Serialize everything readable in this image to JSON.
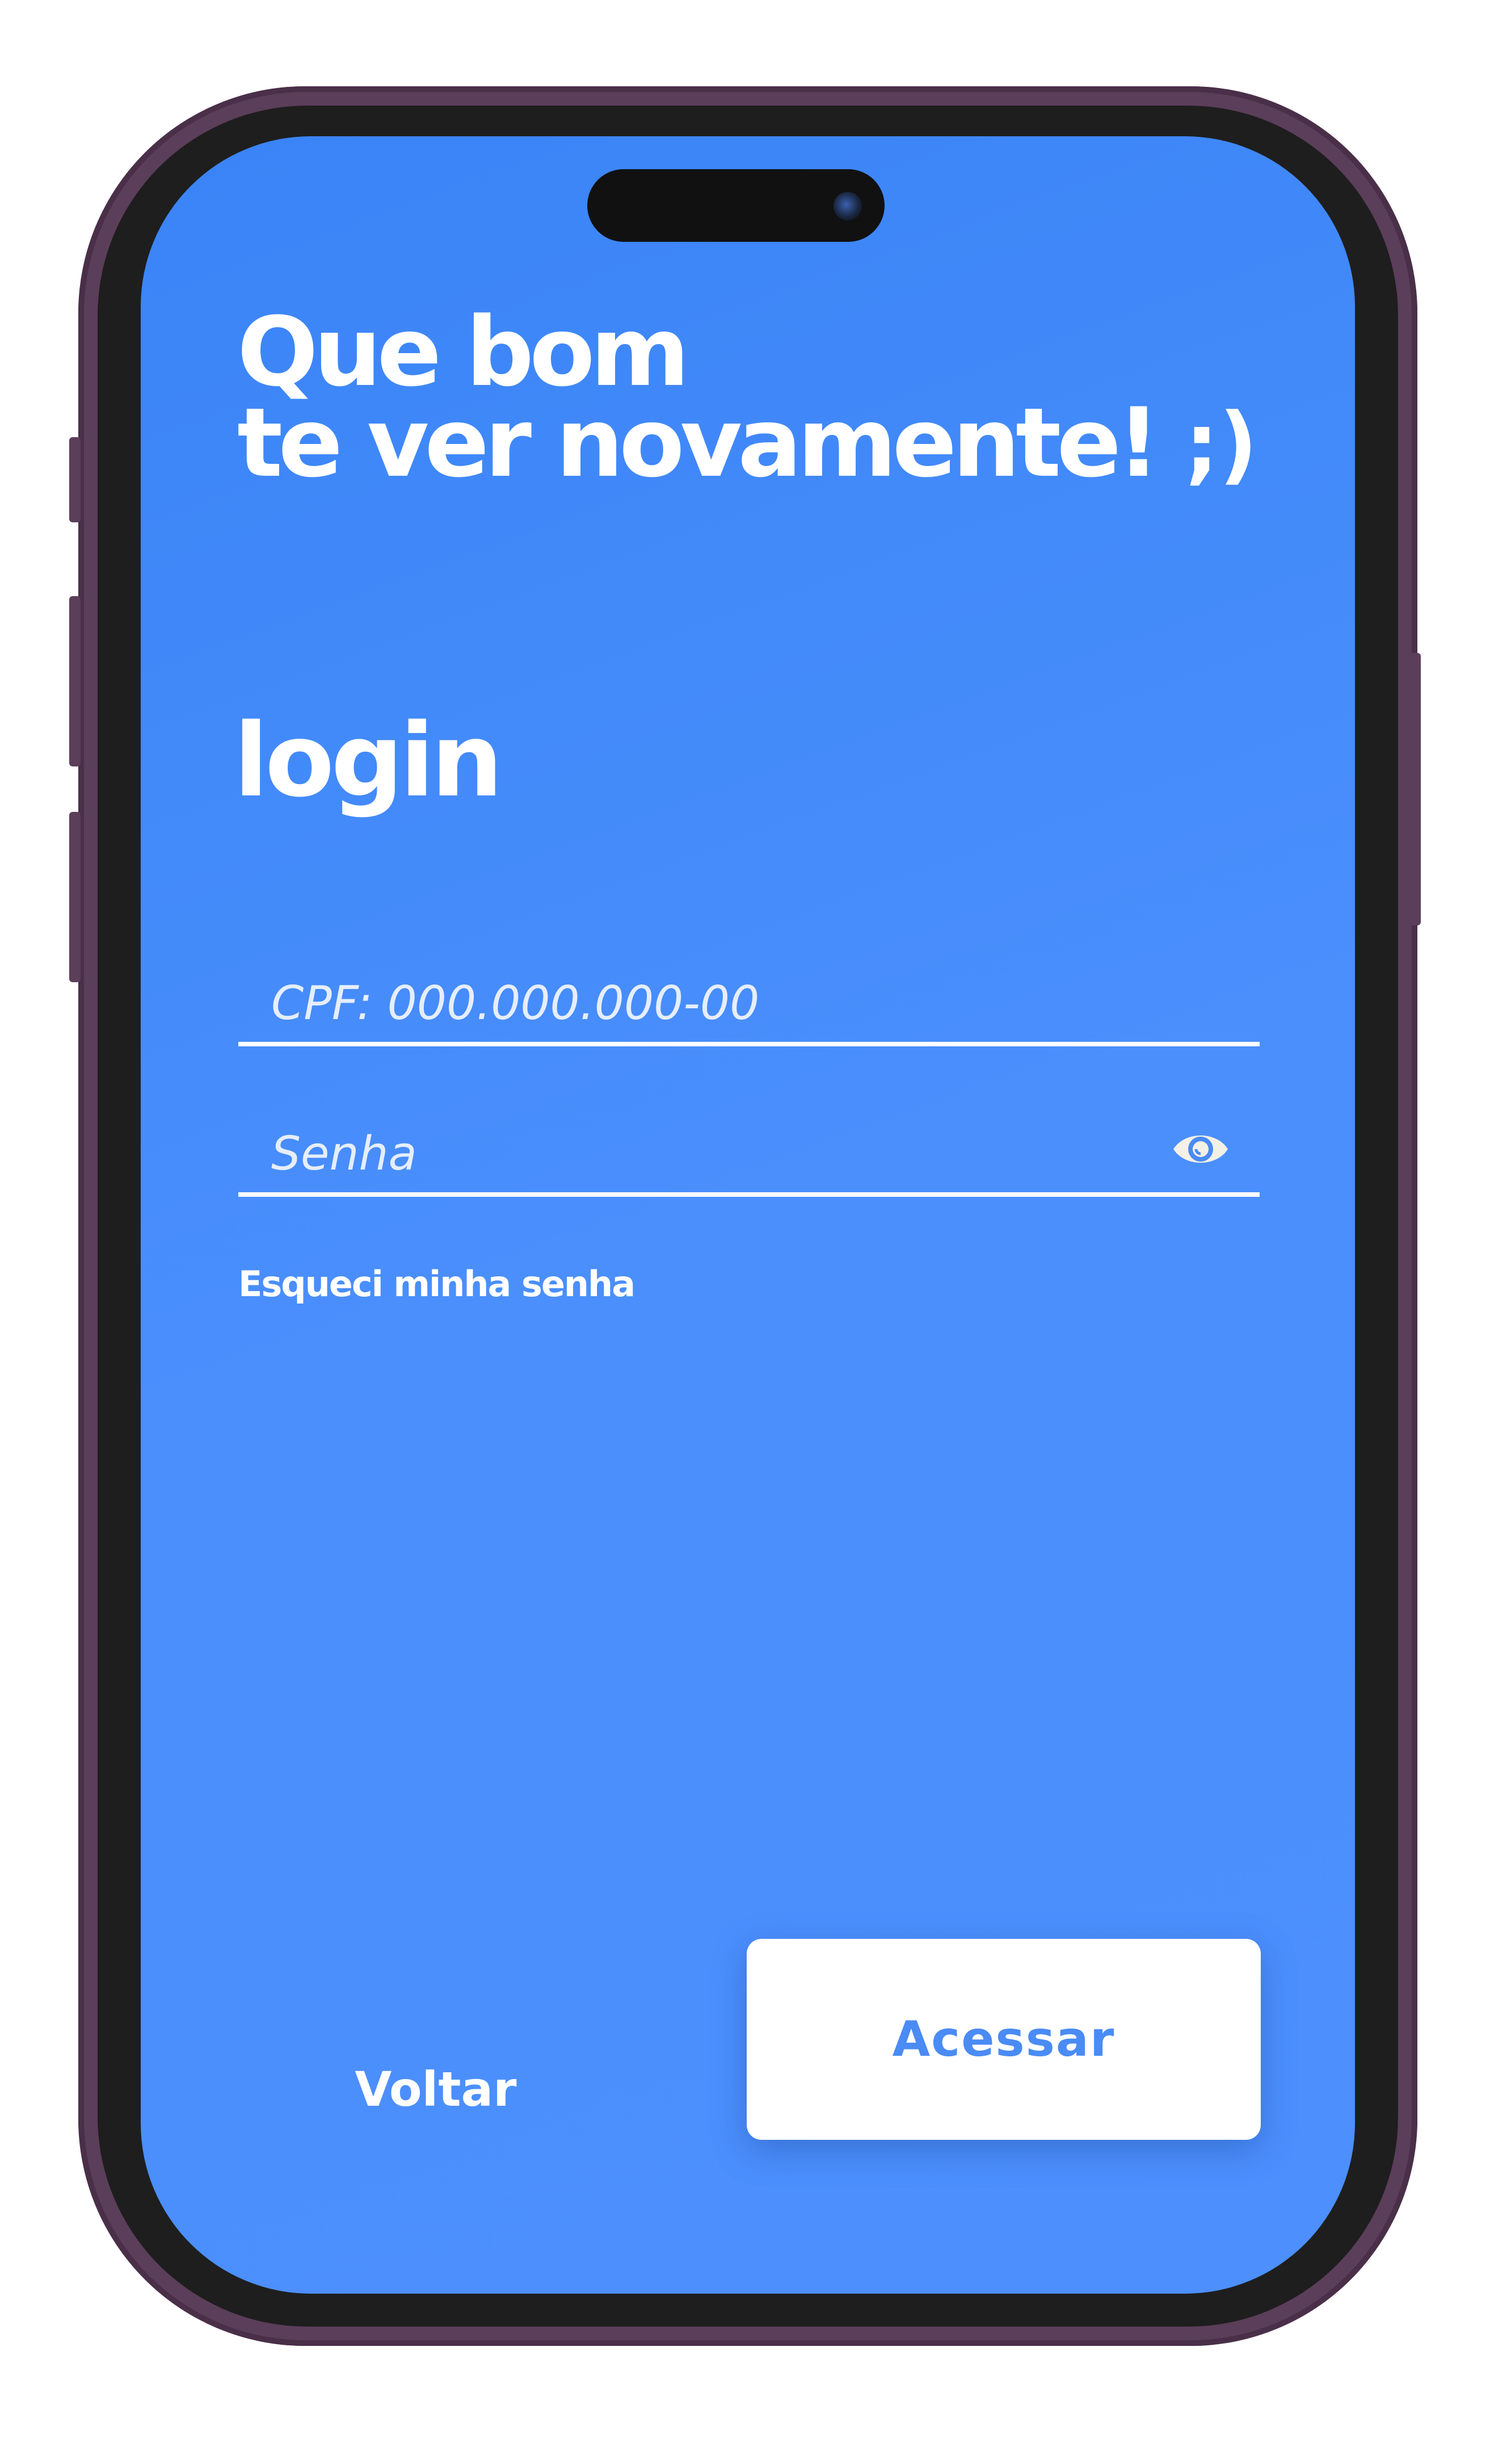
{
  "greeting": {
    "line1": "Que bom",
    "line2": "te ver novamente!",
    "wink": ";)"
  },
  "login": {
    "title": "login",
    "cpf_placeholder": "CPF: 000.000.000-00",
    "senha_placeholder": "Senha",
    "forgot_password": "Esqueci minha senha",
    "show_password_icon": "eye-icon"
  },
  "actions": {
    "back_label": "Voltar",
    "submit_label": "Acessar"
  },
  "colors": {
    "screen_background": "#3A84F7",
    "accent_text": "#4A8BF5",
    "phone_frame": "#5B3E5A"
  }
}
